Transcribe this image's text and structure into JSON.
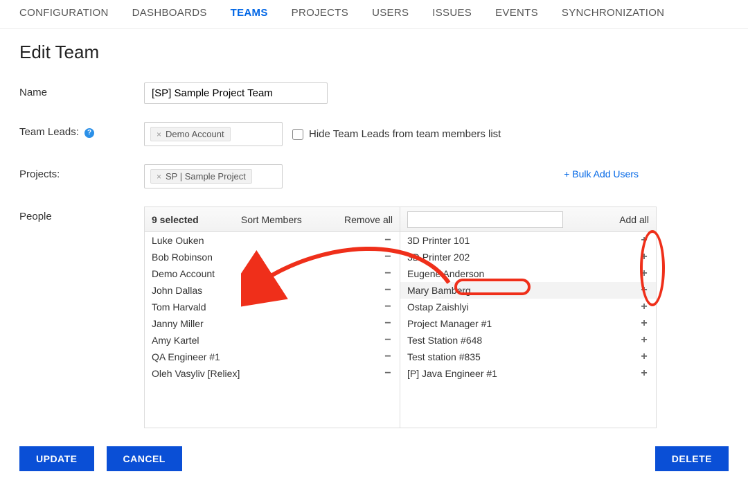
{
  "nav": {
    "items": [
      {
        "label": "CONFIGURATION",
        "active": false
      },
      {
        "label": "DASHBOARDS",
        "active": false
      },
      {
        "label": "TEAMS",
        "active": true
      },
      {
        "label": "PROJECTS",
        "active": false
      },
      {
        "label": "USERS",
        "active": false
      },
      {
        "label": "ISSUES",
        "active": false
      },
      {
        "label": "EVENTS",
        "active": false
      },
      {
        "label": "SYNCHRONIZATION",
        "active": false
      }
    ]
  },
  "page": {
    "title": "Edit Team"
  },
  "form": {
    "name_label": "Name",
    "name_value": "[SP] Sample Project Team",
    "leads_label": "Team Leads:",
    "leads_tag": "Demo Account",
    "hide_leads_label": "Hide Team Leads from team members list",
    "projects_label": "Projects:",
    "projects_tag": "SP | Sample Project",
    "bulk_link": "+ Bulk Add Users",
    "people_label": "People"
  },
  "duallist": {
    "left": {
      "count_label": "9 selected",
      "sort_label": "Sort Members",
      "remove_all": "Remove all",
      "rows": [
        "Luke Ouken",
        "Bob Robinson",
        "Demo Account",
        "John Dallas",
        "Tom Harvald",
        "Janny Miller",
        "Amy Kartel",
        "QA Engineer #1",
        "Oleh Vasyliv [Reliex]"
      ]
    },
    "right": {
      "add_all": "Add all",
      "rows": [
        {
          "name": "3D Printer 101",
          "hl": false
        },
        {
          "name": "3D Printer 202",
          "hl": false
        },
        {
          "name": "Eugene Anderson",
          "hl": false
        },
        {
          "name": "Mary Bamberg",
          "hl": true
        },
        {
          "name": "Ostap Zaishlyi",
          "hl": false
        },
        {
          "name": "Project Manager #1",
          "hl": false
        },
        {
          "name": "Test Station #648",
          "hl": false
        },
        {
          "name": "Test station #835",
          "hl": false
        },
        {
          "name": "[P] Java Engineer #1",
          "hl": false
        }
      ]
    }
  },
  "buttons": {
    "update": "UPDATE",
    "cancel": "CANCEL",
    "delete": "DELETE"
  }
}
